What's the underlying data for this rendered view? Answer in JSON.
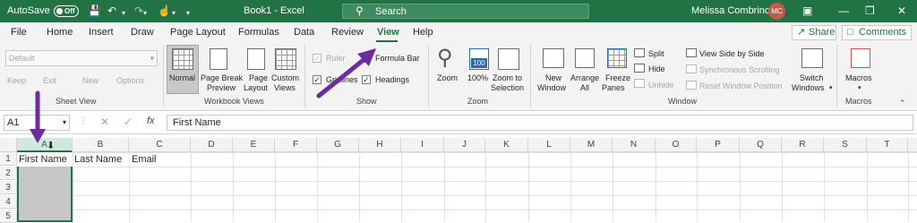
{
  "titlebar": {
    "autosave_label": "AutoSave",
    "autosave_state": "Off",
    "title": "Book1  -  Excel",
    "search_placeholder": "Search",
    "user_name": "Melissa Combrinck",
    "user_initials": "MC"
  },
  "tabs": [
    "File",
    "Home",
    "Insert",
    "Draw",
    "Page Layout",
    "Formulas",
    "Data",
    "Review",
    "View",
    "Help"
  ],
  "active_tab": "View",
  "share_label": "Share",
  "comments_label": "Comments",
  "ribbon": {
    "sheet_view": {
      "label": "Sheet View",
      "dropdown_value": "Default",
      "keep": "Keep",
      "exit": "Exit",
      "new": "New",
      "options": "Options"
    },
    "workbook_views": {
      "label": "Workbook Views",
      "normal": "Normal",
      "page_break_1": "Page Break",
      "page_break_2": "Preview",
      "page_layout_1": "Page",
      "page_layout_2": "Layout",
      "custom_1": "Custom",
      "custom_2": "Views"
    },
    "show": {
      "label": "Show",
      "ruler": "Ruler",
      "formula_bar": "Formula Bar",
      "gridlines": "Gridlines",
      "headings": "Headings"
    },
    "zoom": {
      "label": "Zoom",
      "zoom": "Zoom",
      "hundred": "100%",
      "zoom_sel_1": "Zoom to",
      "zoom_sel_2": "Selection"
    },
    "window": {
      "label": "Window",
      "new_window_1": "New",
      "new_window_2": "Window",
      "arrange_1": "Arrange",
      "arrange_2": "All",
      "freeze_1": "Freeze",
      "freeze_2": "Panes",
      "split": "Split",
      "hide": "Hide",
      "unhide": "Unhide",
      "side_by_side": "View Side by Side",
      "sync_scroll": "Synchronous Scrolling",
      "reset_pos": "Reset Window Position",
      "switch_1": "Switch",
      "switch_2": "Windows"
    },
    "macros": {
      "label": "Macros",
      "macros": "Macros"
    }
  },
  "formula_bar": {
    "name_box": "A1",
    "content": "First Name"
  },
  "columns": [
    "A",
    "B",
    "C",
    "D",
    "E",
    "F",
    "G",
    "H",
    "I",
    "J",
    "K",
    "L",
    "M",
    "N",
    "O",
    "P",
    "Q",
    "R",
    "S",
    "T"
  ],
  "rows": [
    "1",
    "2",
    "3",
    "4",
    "5"
  ],
  "cells": {
    "A1": "First Name",
    "B1": "Last Name",
    "C1": "Email"
  },
  "colors": {
    "accent": "#217346",
    "annotation_arrow": "#6a2c9e"
  }
}
